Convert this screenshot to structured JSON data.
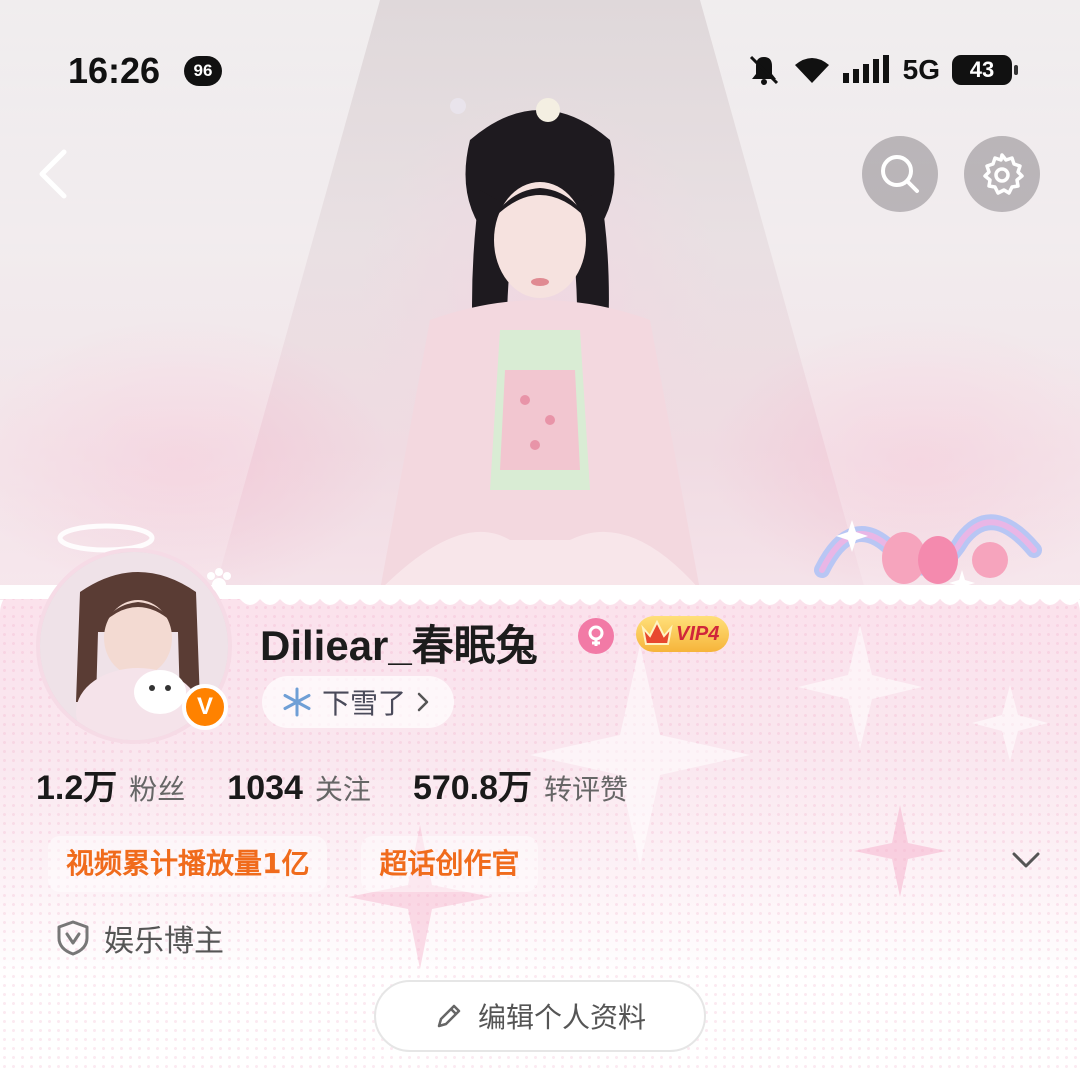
{
  "status_bar": {
    "time": "16:26",
    "notification_count": "96",
    "network": "5G",
    "battery": "43"
  },
  "nav": {
    "back_icon": "chevron-left-icon",
    "search_icon": "search-icon",
    "settings_icon": "gear-icon"
  },
  "profile": {
    "username": "Diliear_春眠兔",
    "verified_badge": "V",
    "gender_icon": "female-icon",
    "vip_label": "VIP4",
    "weather": {
      "icon": "snowflake-icon",
      "label": "下雪了"
    },
    "stats": [
      {
        "value": "1.2万",
        "label": "粉丝"
      },
      {
        "value": "1034",
        "label": "关注"
      },
      {
        "value": "570.8万",
        "label": "转评赞"
      }
    ],
    "tags": [
      "视频累计播放量1亿",
      "超话创作官"
    ],
    "category": {
      "icon": "shield-v-icon",
      "label": "娱乐博主"
    },
    "edit_button": {
      "icon": "pencil-icon",
      "label": "编辑个人资料"
    }
  },
  "colors": {
    "accent_orange": "#f06b1c",
    "verified": "#ff8200",
    "gender_pink": "#f27aa6",
    "vip_gold": "#f6b43a"
  }
}
